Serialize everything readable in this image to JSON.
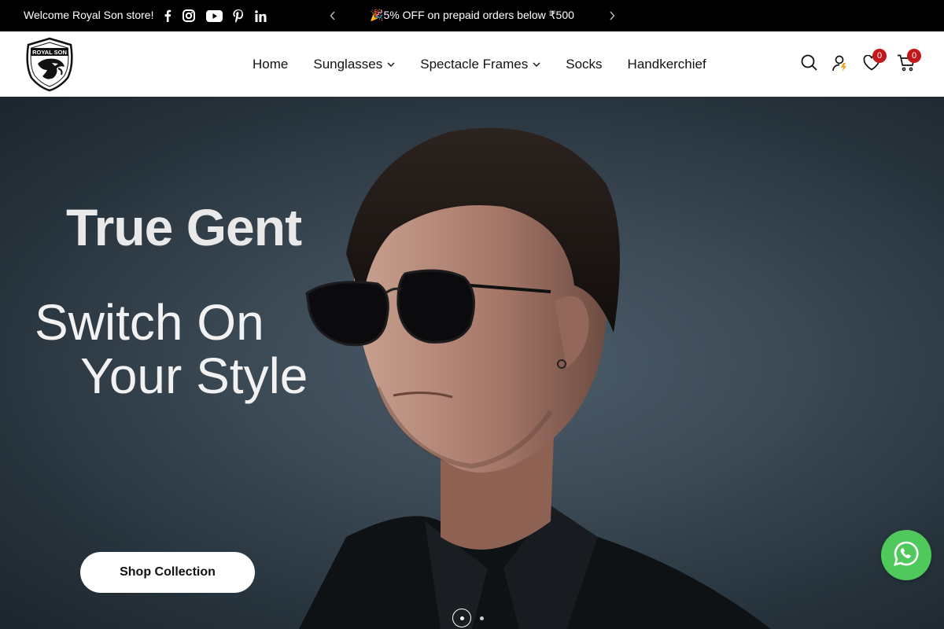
{
  "topbar": {
    "welcome": "Welcome Royal Son store!",
    "socials": [
      "facebook-icon",
      "instagram-icon",
      "youtube-icon",
      "pinterest-icon",
      "linkedin-icon"
    ],
    "announcement": "🎉5% OFF on prepaid orders below ₹500"
  },
  "header": {
    "logo_text": "ROYAL SON",
    "nav": [
      {
        "label": "Home",
        "has_dropdown": false
      },
      {
        "label": "Sunglasses",
        "has_dropdown": true
      },
      {
        "label": "Spectacle Frames",
        "has_dropdown": true
      },
      {
        "label": "Socks",
        "has_dropdown": false
      },
      {
        "label": "Handkerchief",
        "has_dropdown": false
      }
    ],
    "wishlist_count": "0",
    "cart_count": "0"
  },
  "hero": {
    "title": "True Gent",
    "subtitle_line1": "Switch On",
    "subtitle_line2": "Your Style",
    "button_label": "Shop Collection",
    "slide_count": 2,
    "active_slide": 1
  },
  "colors": {
    "topbar_bg": "#000000",
    "badge": "#c2171b",
    "whatsapp": "#4fc95b",
    "hero_bg": "#3a4853"
  }
}
